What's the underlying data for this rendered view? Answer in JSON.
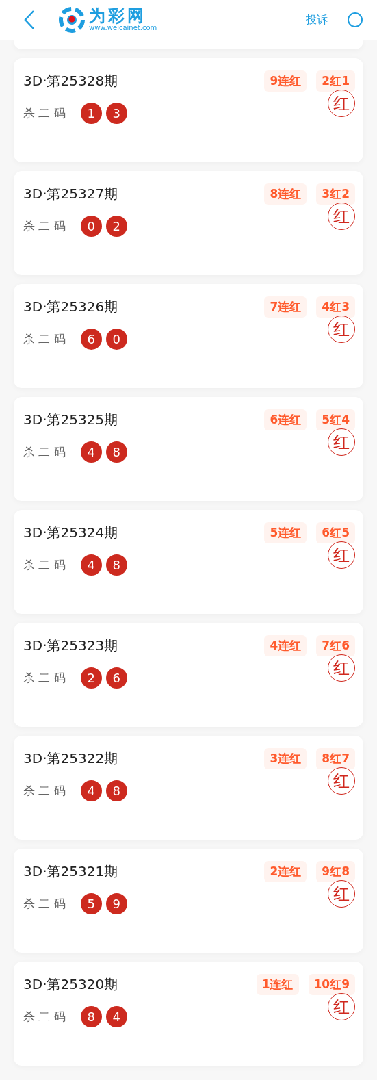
{
  "header": {
    "brand": "为彩网",
    "site": "www.weicainet.com",
    "action": "投诉"
  },
  "items": [
    {
      "title": "3D·第25328期",
      "streak": "9连红",
      "record": "2红1",
      "label": "杀 二 码",
      "numbers": [
        "1",
        "3"
      ],
      "result": "红"
    },
    {
      "title": "3D·第25327期",
      "streak": "8连红",
      "record": "3红2",
      "label": "杀 二 码",
      "numbers": [
        "0",
        "2"
      ],
      "result": "红"
    },
    {
      "title": "3D·第25326期",
      "streak": "7连红",
      "record": "4红3",
      "label": "杀 二 码",
      "numbers": [
        "6",
        "0"
      ],
      "result": "红"
    },
    {
      "title": "3D·第25325期",
      "streak": "6连红",
      "record": "5红4",
      "label": "杀 二 码",
      "numbers": [
        "4",
        "8"
      ],
      "result": "红"
    },
    {
      "title": "3D·第25324期",
      "streak": "5连红",
      "record": "6红5",
      "label": "杀 二 码",
      "numbers": [
        "4",
        "8"
      ],
      "result": "红"
    },
    {
      "title": "3D·第25323期",
      "streak": "4连红",
      "record": "7红6",
      "label": "杀 二 码",
      "numbers": [
        "2",
        "6"
      ],
      "result": "红"
    },
    {
      "title": "3D·第25322期",
      "streak": "3连红",
      "record": "8红7",
      "label": "杀 二 码",
      "numbers": [
        "4",
        "8"
      ],
      "result": "红"
    },
    {
      "title": "3D·第25321期",
      "streak": "2连红",
      "record": "9红8",
      "label": "杀 二 码",
      "numbers": [
        "5",
        "9"
      ],
      "result": "红"
    },
    {
      "title": "3D·第25320期",
      "streak": "1连红",
      "record": "10红9",
      "label": "杀 二 码",
      "numbers": [
        "8",
        "4"
      ],
      "result": "红"
    }
  ]
}
